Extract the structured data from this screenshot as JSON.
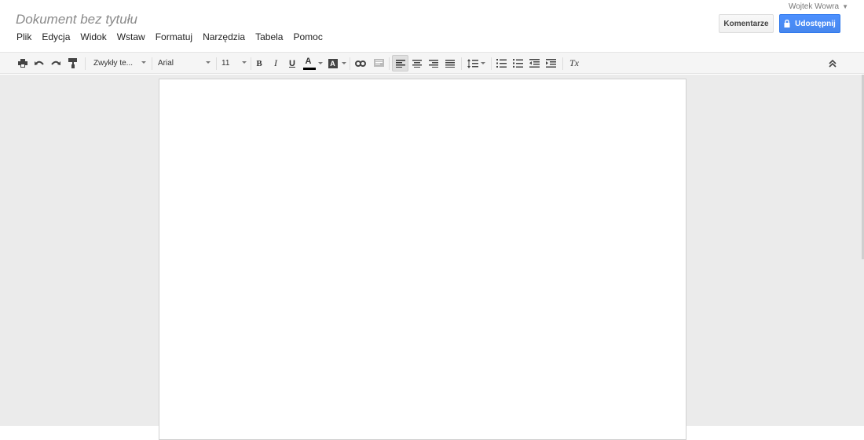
{
  "header": {
    "doc_title": "Dokument bez tytułu",
    "user_name": "Wojtek Wowra",
    "comments_label": "Komentarze",
    "share_label": "Udostępnij",
    "menu": [
      "Plik",
      "Edycja",
      "Widok",
      "Wstaw",
      "Formatuj",
      "Narzędzia",
      "Tabela",
      "Pomoc"
    ]
  },
  "toolbar": {
    "style_value": "Zwykły te...",
    "font_value": "Arial",
    "size_value": "11",
    "bold_label": "B",
    "italic_label": "I",
    "underline_label": "U",
    "text_color_label": "A",
    "highlight_label": "A",
    "clear_format_label": "Tx",
    "icons": [
      "print-icon",
      "undo-icon",
      "redo-icon",
      "paint-format-icon",
      "link-icon",
      "comment-icon",
      "align-left-icon",
      "align-center-icon",
      "align-right-icon",
      "align-justify-icon",
      "line-spacing-icon",
      "numbered-list-icon",
      "bulleted-list-icon",
      "decrease-indent-icon",
      "increase-indent-icon",
      "clear-formatting-icon",
      "collapse-icon"
    ]
  },
  "colors": {
    "share_blue": "#4d90fe",
    "text_color_bar": "#000000",
    "canvas_bg": "#ebebeb"
  }
}
